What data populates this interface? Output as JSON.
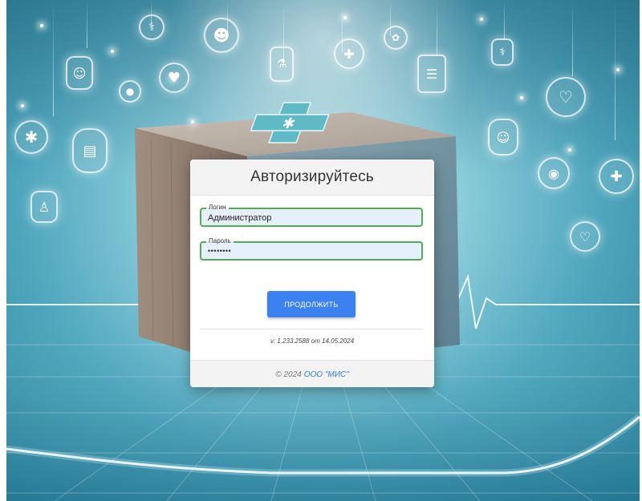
{
  "background": {
    "icons": [
      "medical-cross-icon",
      "clipboard-icon",
      "heart-icon",
      "doctor-icon",
      "test-tube-icon",
      "nurse-icon",
      "document-icon",
      "ecg-icon"
    ]
  },
  "login": {
    "title": "Авторизируйтесь",
    "login_label": "Логин",
    "login_value": "Администратор",
    "password_label": "Пароль",
    "password_value": "••••••••",
    "continue_button": "ПРОДОЛЖИТЬ",
    "version": "v: 1.233.2588 от 14.05.2024",
    "copyright": "© 2024",
    "company_link": "ООО \"МИС\""
  },
  "colors": {
    "accent": "#3b82f0",
    "field_border": "#4caf50",
    "field_bg": "#e8effc",
    "link": "#2f7de1"
  }
}
